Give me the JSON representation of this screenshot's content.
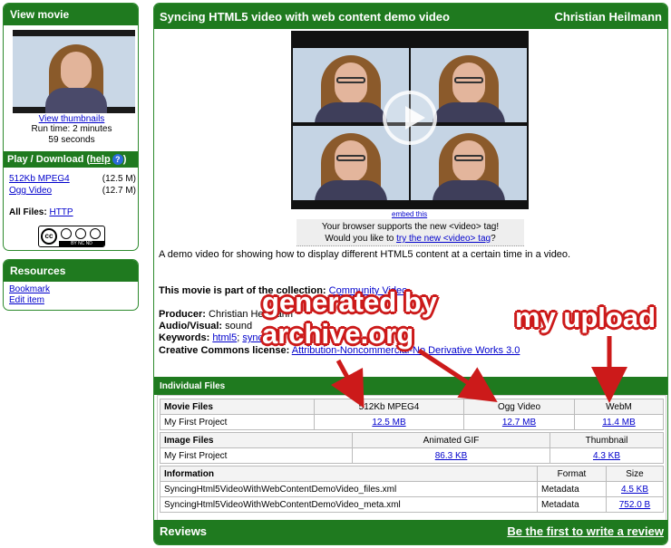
{
  "sidebar": {
    "view_movie": {
      "title": "View movie",
      "thumbnails_link": "View thumbnails",
      "runtime": "Run time: 2 minutes 59 seconds",
      "play_download_label": "Play / Download (",
      "help_link": "help",
      "play_download_close": ")",
      "downloads": [
        {
          "label": "512Kb MPEG4",
          "size": "(12.5 M)"
        },
        {
          "label": "Ogg Video",
          "size": "(12.7 M)"
        }
      ],
      "all_files_label": "All Files:",
      "all_files_link": "HTTP",
      "cc_badge": "BY NC ND"
    },
    "resources": {
      "title": "Resources",
      "links": [
        "Bookmark",
        "Edit item"
      ]
    }
  },
  "main": {
    "title": "Syncing HTML5 video with web content demo video",
    "author": "Christian Heilmann",
    "embed_link": "embed this",
    "notice_line1": "Your browser supports the new <video> tag!",
    "notice_line2_prefix": "Would you like to ",
    "notice_link": "try the new <video> tag",
    "notice_line2_suffix": "?",
    "description": "A demo video for showing how to display different HTML5 content at a certain time in a video.",
    "collection_label": "This movie is part of the collection:",
    "collection_link": "Community Video",
    "producer_label": "Producer:",
    "producer_value": "Christian Heilmann",
    "av_label": "Audio/Visual:",
    "av_value": "sound",
    "keywords_label": "Keywords:",
    "keywords": [
      "html5",
      "sync"
    ],
    "license_label": "Creative Commons license:",
    "license_link": "Attribution-Noncommercial-No Derivative Works 3.0"
  },
  "files": {
    "section_title": "Individual Files",
    "movie": {
      "header": "Movie Files",
      "columns": [
        "512Kb MPEG4",
        "Ogg Video",
        "WebM"
      ],
      "row_name": "My First Project",
      "sizes": [
        "12.5 MB",
        "12.7 MB",
        "11.4 MB"
      ]
    },
    "image": {
      "header": "Image Files",
      "columns": [
        "Animated GIF",
        "Thumbnail"
      ],
      "row_name": "My First Project",
      "sizes": [
        "86.3 KB",
        "4.3 KB"
      ]
    },
    "info": {
      "header": "Information",
      "columns": [
        "Format",
        "Size"
      ],
      "rows": [
        {
          "name": "SyncingHtml5VideoWithWebContentDemoVideo_files.xml",
          "format": "Metadata",
          "size": "4.5 KB"
        },
        {
          "name": "SyncingHtml5VideoWithWebContentDemoVideo_meta.xml",
          "format": "Metadata",
          "size": "752.0 B"
        }
      ]
    }
  },
  "reviews": {
    "title": "Reviews",
    "cta": "Be the first to write a review"
  },
  "annotations": {
    "archive_line1": "generated by",
    "archive_line2": "archive.org",
    "upload": "my upload",
    "color": "#cc1a1a"
  },
  "colors": {
    "header_green": "#1f7a1f",
    "link_blue": "#0000cc"
  }
}
